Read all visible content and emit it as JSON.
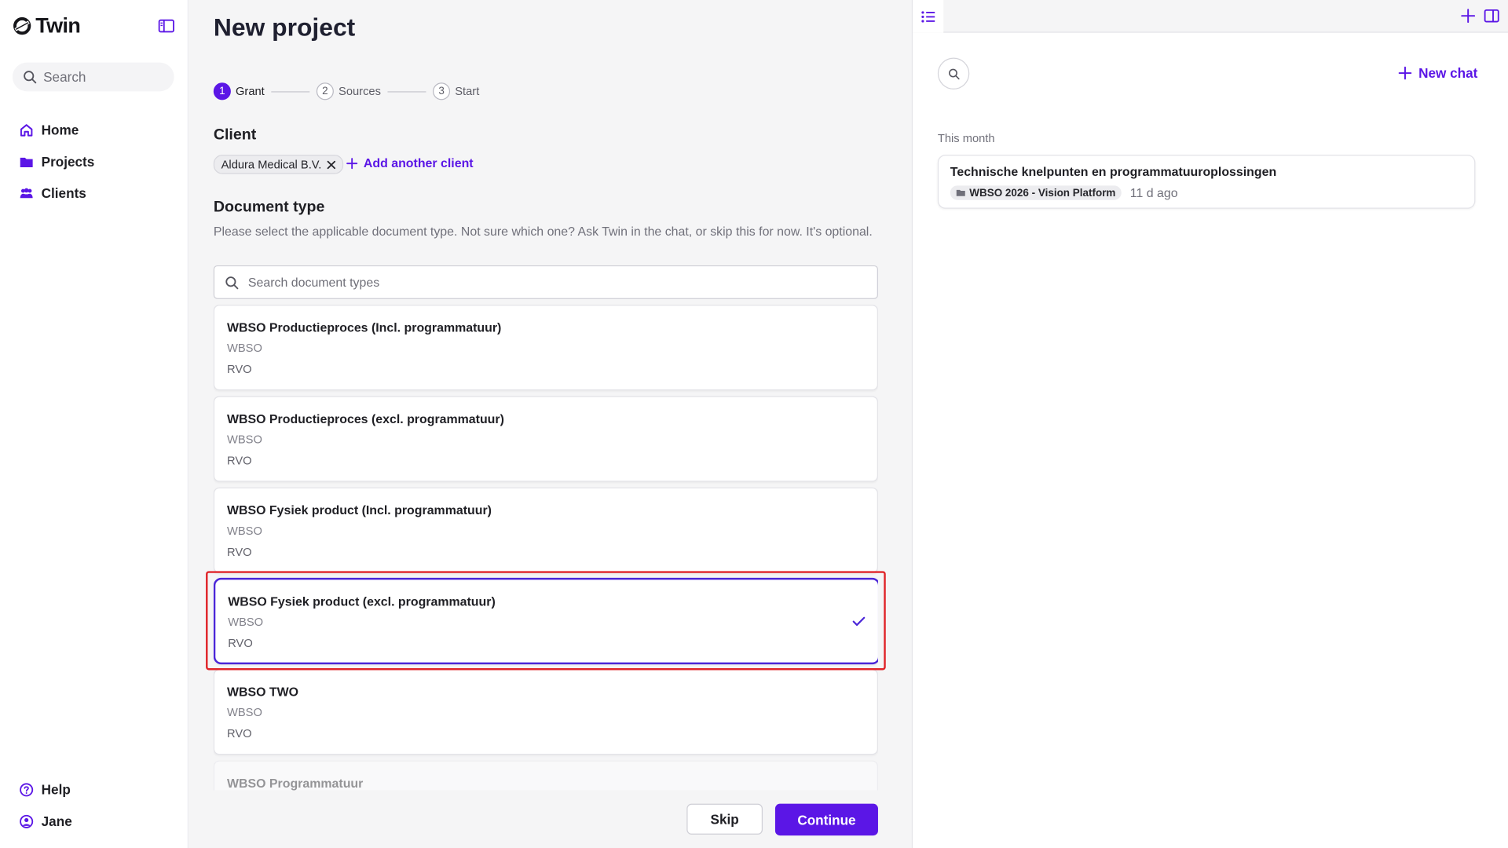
{
  "app": {
    "name": "Twin"
  },
  "colors": {
    "accent": "#5b16e6",
    "highlight": "#e0252a"
  },
  "sidebar": {
    "search_label": "Search",
    "nav": [
      {
        "label": "Home",
        "icon": "home-icon"
      },
      {
        "label": "Projects",
        "icon": "folder-icon"
      },
      {
        "label": "Clients",
        "icon": "users-icon"
      }
    ],
    "footer": [
      {
        "label": "Help",
        "icon": "help-icon"
      },
      {
        "label": "Jane",
        "icon": "user-icon"
      }
    ]
  },
  "main": {
    "title": "New project",
    "steps": [
      {
        "num": "1",
        "label": "Grant",
        "active": true
      },
      {
        "num": "2",
        "label": "Sources",
        "active": false
      },
      {
        "num": "3",
        "label": "Start",
        "active": false
      }
    ],
    "client_section": {
      "title": "Client",
      "chip": "Aldura Medical B.V.",
      "add_label": "Add another client"
    },
    "doc_type_section": {
      "title": "Document type",
      "helper": "Please select the applicable document type. Not sure which one? Ask Twin in the chat, or skip this for now. It's optional.",
      "search_placeholder": "Search document types",
      "options": [
        {
          "name": "WBSO Productieproces (Incl. programmatuur)",
          "line1": "WBSO",
          "line2": "RVO",
          "selected": false
        },
        {
          "name": "WBSO Productieproces (excl. programmatuur)",
          "line1": "WBSO",
          "line2": "RVO",
          "selected": false
        },
        {
          "name": "WBSO Fysiek product (Incl. programmatuur)",
          "line1": "WBSO",
          "line2": "RVO",
          "selected": false
        },
        {
          "name": "WBSO Fysiek product (excl. programmatuur)",
          "line1": "WBSO",
          "line2": "RVO",
          "selected": true
        },
        {
          "name": "WBSO TWO",
          "line1": "WBSO",
          "line2": "RVO",
          "selected": false
        },
        {
          "name": "WBSO Programmatuur",
          "line1": "",
          "line2": "",
          "selected": false
        }
      ]
    },
    "actions": {
      "skip_label": "Skip",
      "continue_label": "Continue"
    }
  },
  "chat_panel": {
    "new_chat_label": "New chat",
    "group_label": "This month",
    "chats": [
      {
        "title": "Technische knelpunten en programmatuuroplossingen",
        "tag": "WBSO 2026 - Vision Platform",
        "time": "11 d ago"
      }
    ]
  }
}
